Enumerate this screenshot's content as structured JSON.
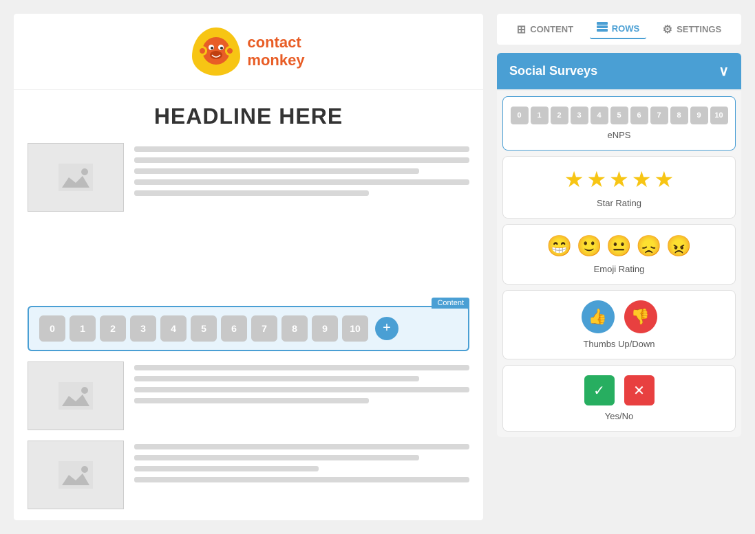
{
  "tabs": {
    "content_label": "CONTENT",
    "rows_label": "ROWS",
    "settings_label": "SETTINGS",
    "active": "rows"
  },
  "social_surveys": {
    "title": "Social Surveys",
    "chevron": "∨"
  },
  "survey_cards": [
    {
      "id": "enps",
      "label": "eNPS",
      "numbers": [
        "0",
        "1",
        "2",
        "3",
        "4",
        "5",
        "6",
        "7",
        "8",
        "9",
        "10"
      ]
    },
    {
      "id": "star-rating",
      "label": "Star Rating"
    },
    {
      "id": "emoji-rating",
      "label": "Emoji Rating"
    },
    {
      "id": "thumbs",
      "label": "Thumbs Up/Down"
    },
    {
      "id": "yesno",
      "label": "Yes/No"
    }
  ],
  "email_preview": {
    "headline": "HEADLINE HERE",
    "content_badge": "Content",
    "nps_numbers": [
      "0",
      "1",
      "2",
      "3",
      "4",
      "5",
      "6",
      "7",
      "8",
      "9",
      "10"
    ]
  },
  "logo": {
    "contact": "contact",
    "monkey": "monkey"
  }
}
